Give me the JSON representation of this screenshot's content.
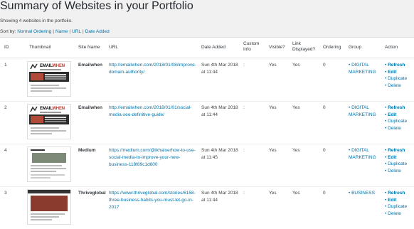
{
  "header": {
    "title": "Summary of Websites in your Portfolio",
    "count_text": "Showing 4 websites in the portfolio.",
    "sort_label": "Sort by:",
    "sort_options": [
      "Normal Ordering",
      "Name",
      "URL",
      "Date Added"
    ]
  },
  "columns": [
    "ID",
    "Thumbnail",
    "Site Name",
    "URL",
    "Date Added",
    "Custom Info",
    "Visible?",
    "Link Displayed?",
    "Ordering",
    "Group",
    "Action"
  ],
  "rows": [
    {
      "id": "1",
      "site_name": "Emailwhen",
      "url": "http://emailwhen.com/2018/01/08/improve-domain-authority/",
      "date": "Sun 4th Mar 2018 at 11:44",
      "custom_info": ":",
      "visible": "Yes",
      "link_displayed": "Yes",
      "ordering": "0",
      "group": "DIGITAL MARKETING",
      "thumbnail": "emailwhen"
    },
    {
      "id": "2",
      "site_name": "Emailwhen",
      "url": "http://emailwhen.com/2018/01/01/social-media-seo-definitive-guide/",
      "date": "Sun 4th Mar 2018 at 11:44",
      "custom_info": ":",
      "visible": "Yes",
      "link_displayed": "Yes",
      "ordering": "0",
      "group": "DIGITAL MARKETING",
      "thumbnail": "emailwhen"
    },
    {
      "id": "4",
      "site_name": "Medium",
      "url": "https://medium.com/@ikhaloe/how-to-use-social-media-to-improve-your-new-business-118f89c1d600",
      "date": "Sun 4th Mar 2018 at 11:45",
      "custom_info": ":",
      "visible": "Yes",
      "link_displayed": "Yes",
      "ordering": "0",
      "group": "DIGITAL MARKETING",
      "thumbnail": "medium"
    },
    {
      "id": "3",
      "site_name": "Thriveglobal",
      "url": "https://www.thriveglobal.com/stories/6158-three-business-habits-you-must-let-go-in-2017",
      "date": "Sun 4th Mar 2018 at 11:44",
      "custom_info": ":",
      "visible": "Yes",
      "link_displayed": "Yes",
      "ordering": "0",
      "group": "BUSINESS",
      "thumbnail": "thriveglobal"
    }
  ],
  "actions": {
    "refresh": "Refresh",
    "edit": "Edit",
    "duplicate": "Duplicate",
    "delete": "Delete"
  },
  "colors": {
    "link": "#0073aa",
    "background": "#f1f1f1"
  }
}
